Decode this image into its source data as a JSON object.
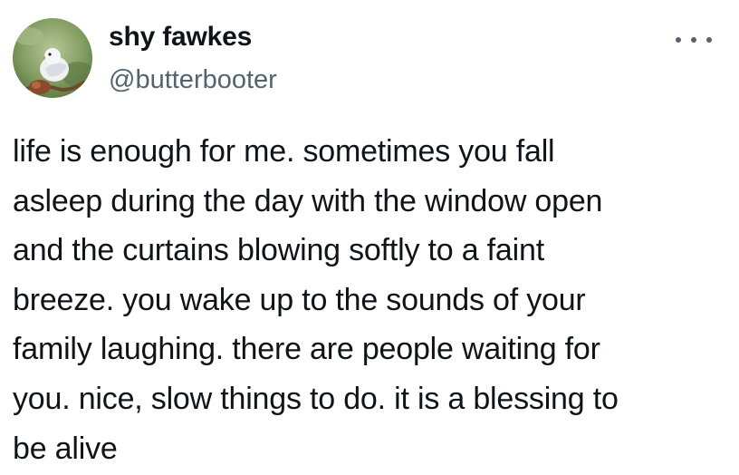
{
  "author": {
    "display_name": "shy fawkes",
    "handle": "@butterbooter",
    "avatar_icon": "dove-avatar"
  },
  "more_icon": "more-horizontal-icon",
  "tweet": {
    "text": "life is enough for me. sometimes you fall\nasleep during the day with the window open\nand the curtains blowing softly to a faint\nbreeze. you wake up to the sounds of your\nfamily laughing. there are people waiting for\nyou. nice, slow things to do. it is a blessing to\nbe alive"
  },
  "colors": {
    "text_primary": "#0f1419",
    "text_secondary": "#536471",
    "background": "#ffffff"
  }
}
